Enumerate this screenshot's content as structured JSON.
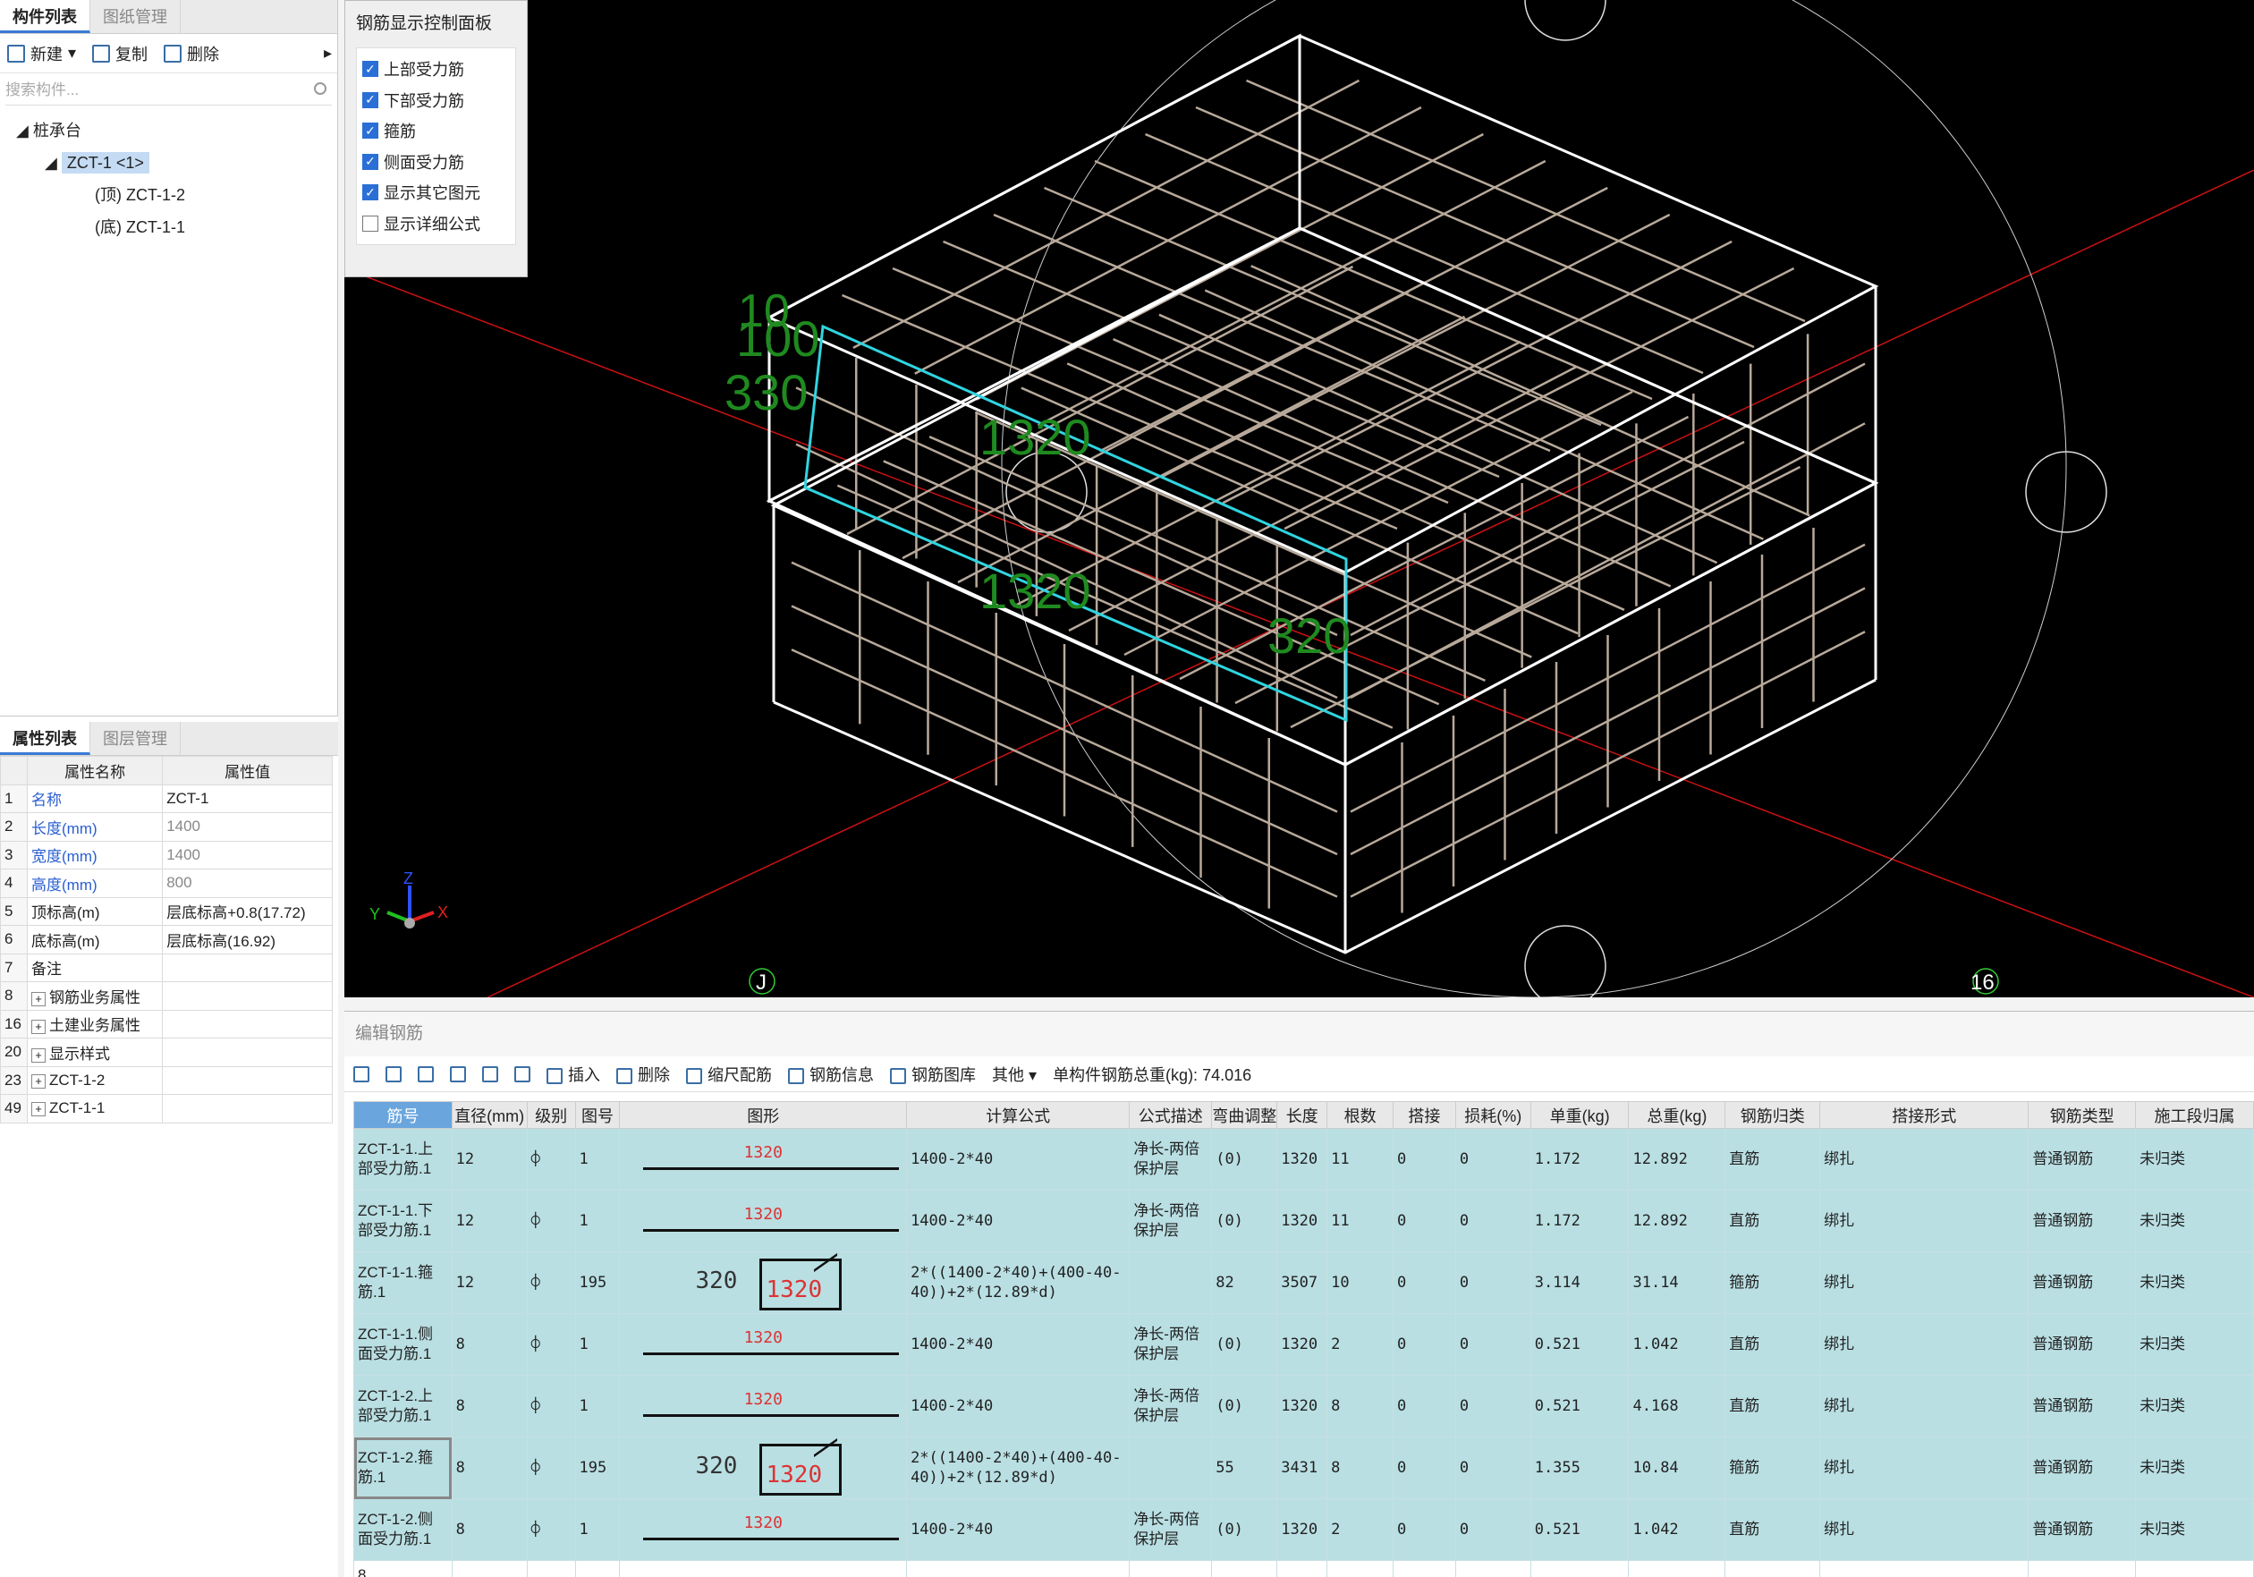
{
  "left_panel": {
    "tabs": [
      "构件列表",
      "图纸管理"
    ],
    "toolbar": {
      "new": "新建",
      "copy": "复制",
      "delete": "删除"
    },
    "search_placeholder": "搜索构件...",
    "tree": {
      "root": "桩承台",
      "node": "ZCT-1 <1>",
      "children": [
        "(顶)  ZCT-1-2",
        "(底)  ZCT-1-1"
      ]
    }
  },
  "property_panel": {
    "tabs": [
      "属性列表",
      "图层管理"
    ],
    "headers": [
      "属性名称",
      "属性值"
    ],
    "rows": [
      {
        "n": "1",
        "name": "名称",
        "value": "ZCT-1"
      },
      {
        "n": "2",
        "name": "长度(mm)",
        "value": "1400"
      },
      {
        "n": "3",
        "name": "宽度(mm)",
        "value": "1400"
      },
      {
        "n": "4",
        "name": "高度(mm)",
        "value": "800"
      },
      {
        "n": "5",
        "name": "顶标高(m)",
        "value": "层底标高+0.8(17.72)"
      },
      {
        "n": "6",
        "name": "底标高(m)",
        "value": "层底标高(16.92)"
      },
      {
        "n": "7",
        "name": "备注",
        "value": ""
      },
      {
        "n": "8",
        "name": "钢筋业务属性",
        "value": ""
      },
      {
        "n": "16",
        "name": "土建业务属性",
        "value": ""
      },
      {
        "n": "20",
        "name": "显示样式",
        "value": ""
      },
      {
        "n": "23",
        "name": "ZCT-1-2",
        "value": ""
      },
      {
        "n": "49",
        "name": "ZCT-1-1",
        "value": ""
      }
    ]
  },
  "control_panel": {
    "title": "钢筋显示控制面板",
    "options": [
      {
        "label": "上部受力筋",
        "checked": true
      },
      {
        "label": "下部受力筋",
        "checked": true
      },
      {
        "label": "箍筋",
        "checked": true
      },
      {
        "label": "侧面受力筋",
        "checked": true
      },
      {
        "label": "显示其它图元",
        "checked": true
      },
      {
        "label": "显示详细公式",
        "checked": false
      }
    ]
  },
  "viewport": {
    "dims": [
      "10",
      "100",
      "330",
      "1320",
      "1320",
      "320"
    ],
    "axis_labels": [
      "J",
      "16"
    ],
    "axes": [
      "Z",
      "Y",
      "X"
    ],
    "colors": {
      "background": "#000000",
      "rebar": "#b8a99a",
      "outline": "#ffffff",
      "dim": "#1f8a1f",
      "axis_line": "#cc1111",
      "highlight": "#2fd5e0"
    }
  },
  "editor": {
    "title": "编辑钢筋",
    "toolbar": {
      "insert": "插入",
      "delete": "删除",
      "scale": "缩尺配筋",
      "info": "钢筋信息",
      "library": "钢筋图库",
      "other": "其他",
      "total": "单构件钢筋总重(kg): 74.016"
    },
    "headers": [
      "筋号",
      "直径(mm)",
      "级别",
      "图号",
      "图形",
      "计算公式",
      "公式描述",
      "弯曲调整",
      "长度",
      "根数",
      "搭接",
      "损耗(%)",
      "单重(kg)",
      "总重(kg)",
      "钢筋归类",
      "搭接形式",
      "钢筋类型",
      "施工段归属"
    ],
    "rows": [
      {
        "n": "1",
        "name": "ZCT-1-1.上部受力筋.1",
        "dia": "12",
        "grade": "⌽",
        "fig": "1",
        "shape": "line",
        "shape_len": "1320",
        "shape_w": "",
        "formula": "1400-2*40",
        "desc": "净长-两倍保护层",
        "bend": "(0)",
        "len": "1320",
        "count": "11",
        "lap": "0",
        "loss": "0",
        "unit": "1.172",
        "total": "12.892",
        "cat": "直筋",
        "lap_form": "绑扎",
        "type": "普通钢筋",
        "seg": "未归类"
      },
      {
        "n": "2",
        "name": "ZCT-1-1.下部受力筋.1",
        "dia": "12",
        "grade": "⌽",
        "fig": "1",
        "shape": "line",
        "shape_len": "1320",
        "shape_w": "",
        "formula": "1400-2*40",
        "desc": "净长-两倍保护层",
        "bend": "(0)",
        "len": "1320",
        "count": "11",
        "lap": "0",
        "loss": "0",
        "unit": "1.172",
        "total": "12.892",
        "cat": "直筋",
        "lap_form": "绑扎",
        "type": "普通钢筋",
        "seg": "未归类"
      },
      {
        "n": "3",
        "name": "ZCT-1-1.箍筋.1",
        "dia": "12",
        "grade": "⌽",
        "fig": "195",
        "shape": "box",
        "shape_len": "1320",
        "shape_w": "320",
        "formula": "2*((1400-2*40)+(400-40-40))+2*(12.89*d)",
        "desc": "",
        "bend": "82",
        "len": "3507",
        "count": "10",
        "lap": "0",
        "loss": "0",
        "unit": "3.114",
        "total": "31.14",
        "cat": "箍筋",
        "lap_form": "绑扎",
        "type": "普通钢筋",
        "seg": "未归类"
      },
      {
        "n": "4",
        "name": "ZCT-1-1.侧面受力筋.1",
        "dia": "8",
        "grade": "⌽",
        "fig": "1",
        "shape": "line",
        "shape_len": "1320",
        "shape_w": "",
        "formula": "1400-2*40",
        "desc": "净长-两倍保护层",
        "bend": "(0)",
        "len": "1320",
        "count": "2",
        "lap": "0",
        "loss": "0",
        "unit": "0.521",
        "total": "1.042",
        "cat": "直筋",
        "lap_form": "绑扎",
        "type": "普通钢筋",
        "seg": "未归类"
      },
      {
        "n": "5",
        "name": "ZCT-1-2.上部受力筋.1",
        "dia": "8",
        "grade": "⌽",
        "fig": "1",
        "shape": "line",
        "shape_len": "1320",
        "shape_w": "",
        "formula": "1400-2*40",
        "desc": "净长-两倍保护层",
        "bend": "(0)",
        "len": "1320",
        "count": "8",
        "lap": "0",
        "loss": "0",
        "unit": "0.521",
        "total": "4.168",
        "cat": "直筋",
        "lap_form": "绑扎",
        "type": "普通钢筋",
        "seg": "未归类"
      },
      {
        "n": "6",
        "name": "ZCT-1-2.箍筋.1",
        "dia": "8",
        "grade": "⌽",
        "fig": "195",
        "shape": "box",
        "shape_len": "1320",
        "shape_w": "320",
        "formula": "2*((1400-2*40)+(400-40-40))+2*(12.89*d)",
        "desc": "",
        "bend": "55",
        "len": "3431",
        "count": "8",
        "lap": "0",
        "loss": "0",
        "unit": "1.355",
        "total": "10.84",
        "cat": "箍筋",
        "lap_form": "绑扎",
        "type": "普通钢筋",
        "seg": "未归类"
      },
      {
        "n": "7",
        "name": "ZCT-1-2.侧面受力筋.1",
        "dia": "8",
        "grade": "⌽",
        "fig": "1",
        "shape": "line",
        "shape_len": "1320",
        "shape_w": "",
        "formula": "1400-2*40",
        "desc": "净长-两倍保护层",
        "bend": "(0)",
        "len": "1320",
        "count": "2",
        "lap": "0",
        "loss": "0",
        "unit": "0.521",
        "total": "1.042",
        "cat": "直筋",
        "lap_form": "绑扎",
        "type": "普通钢筋",
        "seg": "未归类"
      }
    ],
    "empty_row": "8"
  }
}
